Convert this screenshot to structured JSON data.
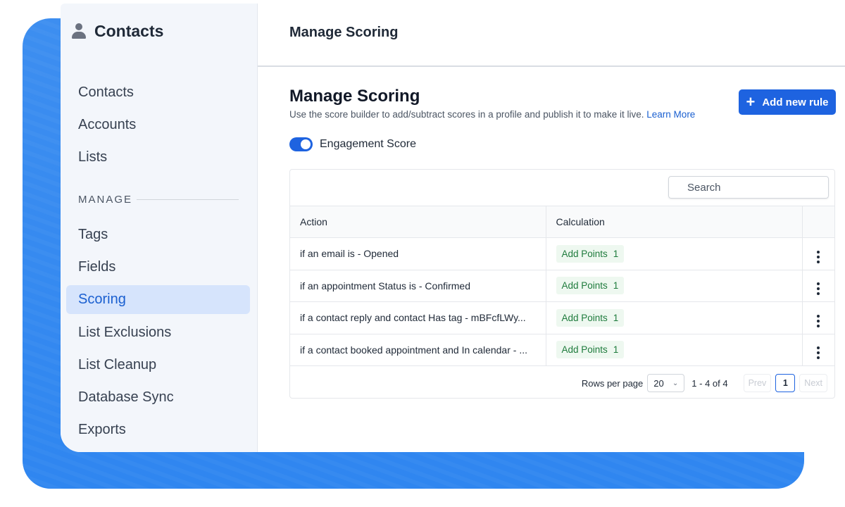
{
  "sidebar": {
    "title": "Contacts",
    "items_top": [
      {
        "label": "Contacts"
      },
      {
        "label": "Accounts"
      },
      {
        "label": "Lists"
      }
    ],
    "section_label": "MANAGE",
    "items_manage": [
      {
        "label": "Tags",
        "active": false
      },
      {
        "label": "Fields",
        "active": false
      },
      {
        "label": "Scoring",
        "active": true
      },
      {
        "label": "List Exclusions",
        "active": false
      },
      {
        "label": "List Cleanup",
        "active": false
      },
      {
        "label": "Database Sync",
        "active": false
      },
      {
        "label": "Exports",
        "active": false
      }
    ]
  },
  "header": {
    "title": "Manage Scoring"
  },
  "main": {
    "title": "Manage Scoring",
    "description": "Use the score builder to add/subtract scores in a profile and publish it to make it live.",
    "learn_more": "Learn More",
    "add_button": "Add new rule",
    "toggle": {
      "label": "Engagement Score",
      "on": true
    },
    "search": {
      "placeholder": "Search",
      "value": ""
    },
    "table": {
      "columns": [
        "Action",
        "Calculation"
      ],
      "rows": [
        {
          "action": "if an email is - Opened",
          "calc_label": "Add Points",
          "calc_value": "1"
        },
        {
          "action": "if an appointment Status is - Confirmed",
          "calc_label": "Add Points",
          "calc_value": "1"
        },
        {
          "action": "if a contact reply and contact Has tag - mBFcfLWy...",
          "calc_label": "Add Points",
          "calc_value": "1"
        },
        {
          "action": "if a contact booked appointment and In calendar - ...",
          "calc_label": "Add Points",
          "calc_value": "1"
        }
      ]
    },
    "pagination": {
      "rows_per_page_label": "Rows per page",
      "rows_per_page": "20",
      "range": "1 - 4 of 4",
      "prev": "Prev",
      "current_page": "1",
      "next": "Next"
    }
  },
  "colors": {
    "accent": "#1e63e0",
    "backdrop": "#2f86f0",
    "badge_bg": "#eef8f0",
    "badge_text": "#1e7b3c",
    "active_nav_bg": "#d6e4fc"
  }
}
